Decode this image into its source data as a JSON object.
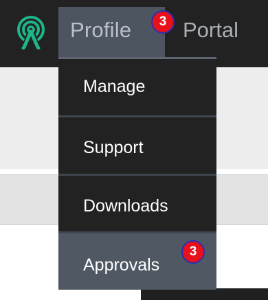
{
  "nav": {
    "logo_icon": "signal-tower-logo-icon",
    "items": [
      {
        "label": "Profile",
        "badge": "3"
      },
      {
        "label": "Portal"
      }
    ]
  },
  "dropdown": {
    "items": [
      {
        "label": "Manage"
      },
      {
        "label": "Support"
      },
      {
        "label": "Downloads"
      },
      {
        "label": "Approvals",
        "badge": "3"
      }
    ]
  },
  "colors": {
    "topbar": "#222222",
    "active": "#4c5560",
    "badge": "#e8101b",
    "badge_border": "#2a2fb4",
    "logo": "#1fb58a"
  }
}
